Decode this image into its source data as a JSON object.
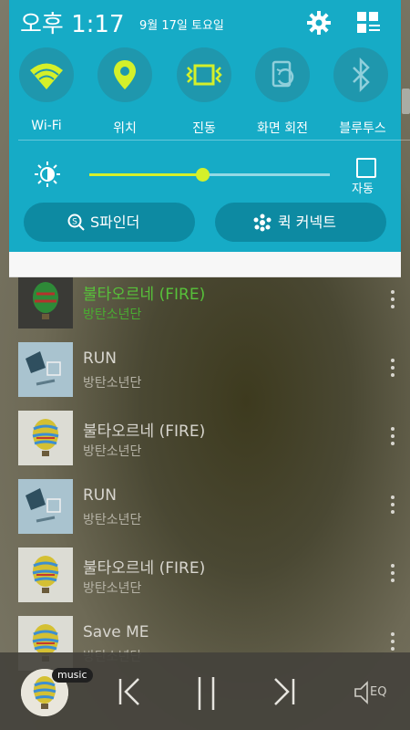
{
  "status": {
    "time": "오후 1:17",
    "date": "9월 17일 토요일"
  },
  "quick_settings": [
    {
      "label": "Wi-Fi",
      "icon": "wifi-icon"
    },
    {
      "label": "위치",
      "icon": "location-icon"
    },
    {
      "label": "진동",
      "icon": "vibrate-icon"
    },
    {
      "label": "화면 회전",
      "icon": "rotate-icon"
    },
    {
      "label": "블루투스",
      "icon": "bluetooth-icon"
    }
  ],
  "brightness": {
    "level": 0.47,
    "auto_label": "자동"
  },
  "pills": {
    "finder": "S파인더",
    "quick_connect": "퀵 커넥트"
  },
  "songs": [
    {
      "title": "불타오르네 (FIRE)",
      "artist": "방탄소년단",
      "active": true
    },
    {
      "title": "RUN",
      "artist": "방탄소년단"
    },
    {
      "title": "불타오르네 (FIRE)",
      "artist": "방탄소년단"
    },
    {
      "title": "RUN",
      "artist": "방탄소년단"
    },
    {
      "title": "불타오르네 (FIRE)",
      "artist": "방탄소년단"
    },
    {
      "title": "Save ME",
      "artist": "방탄소년단"
    }
  ],
  "player": {
    "badge": "music",
    "eq_label": "EQ"
  },
  "colors": {
    "panel": "#16abc6",
    "accent": "#d4f02a",
    "active_song": "#57c23a"
  }
}
